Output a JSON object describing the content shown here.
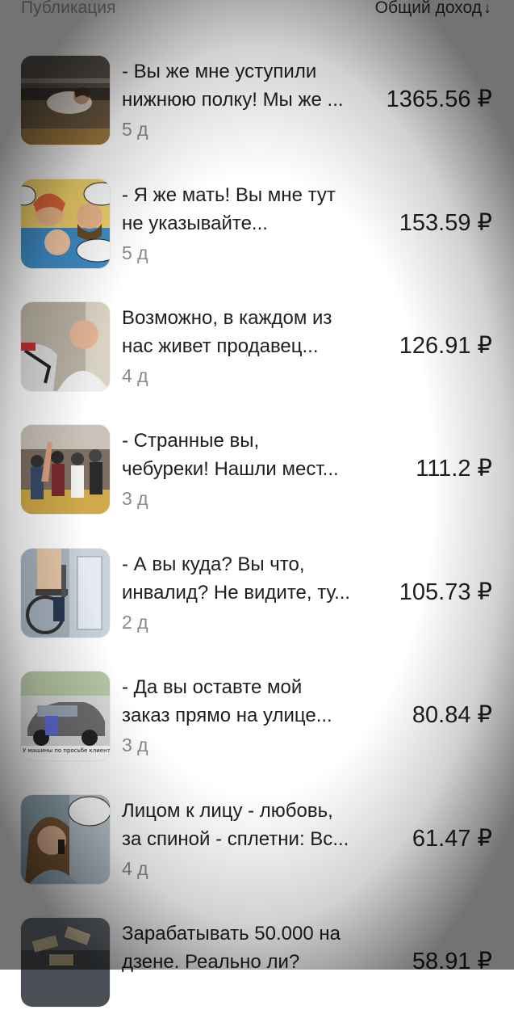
{
  "header": {
    "publication_label": "Публикация",
    "income_label": "Общий доход",
    "sort_icon": "arrow-down-icon",
    "sort_glyph": "↓"
  },
  "currency": "₽",
  "publications": [
    {
      "title_lines": [
        "- Вы же мне уступили",
        "нижнюю полку! Мы же ..."
      ],
      "age": "5 д",
      "income": "1365.56 ₽",
      "thumb": "thumb-train-bunk"
    },
    {
      "title_lines": [
        "- Я же мать! Вы мне тут",
        "не указывайте..."
      ],
      "age": "5 д",
      "income": "153.59 ₽",
      "thumb": "thumb-comic-mother"
    },
    {
      "title_lines": [
        "Возможно, в каждом из",
        "нас живет продавец..."
      ],
      "age": "4 д",
      "income": "126.91 ₽",
      "thumb": "thumb-man-selfie"
    },
    {
      "title_lines": [
        "- Странные вы,",
        "чебуреки! Нашли мест..."
      ],
      "age": "3 д",
      "income": "111.2 ₽",
      "thumb": "thumb-crowd"
    },
    {
      "title_lines": [
        "- А вы куда? Вы что,",
        "инвалид? Не видите, ту..."
      ],
      "age": "2 д",
      "income": "105.73 ₽",
      "thumb": "thumb-wheelchair"
    },
    {
      "title_lines": [
        "- Да вы оставте мой",
        "заказ прямо на улице..."
      ],
      "age": "3 д",
      "income": "80.84 ₽",
      "thumb": "thumb-car",
      "thumb_caption": "У машины по просьбе клиента :D"
    },
    {
      "title_lines": [
        "Лицом к лицу - любовь,",
        "за спиной - сплетни: Вс..."
      ],
      "age": "4 д",
      "income": "61.47 ₽",
      "thumb": "thumb-woman-phone"
    },
    {
      "title_lines": [
        "Зарабатывать 50.000 на",
        "дзене. Реально ли?"
      ],
      "age": "",
      "income": "58.91 ₽",
      "thumb": "thumb-money"
    }
  ]
}
